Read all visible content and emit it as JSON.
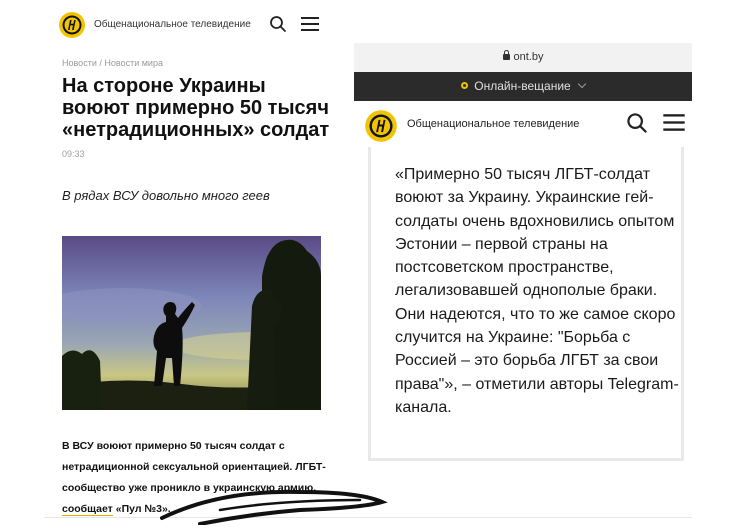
{
  "left": {
    "brand": "Общенациональное телевидение",
    "breadcrumb": [
      "Новости",
      "Новости мира"
    ],
    "breadcrumb_sep": "/",
    "headline": "На стороне Украины воюют примерно 50 тысяч «нетрадиционных» солдат",
    "time": "09:33",
    "lead": "В рядах ВСУ довольно много геев",
    "body_before": "В ВСУ воюют примерно 50 тысяч солдат с нетрадиционной сексуальной ориентацией. ЛГБТ-сообщество уже проникло в украинскую армию, ",
    "body_link": "сообщает",
    "body_after": " «Пул №3»."
  },
  "right": {
    "url": "ont.by",
    "live_label": "Онлайн-вещание",
    "brand": "Общенациональное телевидение",
    "quote": "«Примерно 50 тысяч ЛГБТ-солдат воюют за Украину. Украинские гей-солдаты очень вдохновились опытом Эстонии – первой страны на постсоветском пространстве, легализовавшей однополые браки. Они надеются, что то же самое скоро случится на Украине: \"Борьба с Россией – это борьба ЛГБТ за свои права\"», – отметили авторы Telegram-канала."
  },
  "icons": {
    "logo": "ont-logo-icon",
    "search": "search-icon",
    "menu": "hamburger-menu-icon",
    "lock": "lock-icon",
    "live": "live-dot-icon",
    "chevron": "chevron-down-icon"
  },
  "colors": {
    "logo_yellow": "#f2c400",
    "live_bar": "#2b2b2b",
    "text": "#1a1a1a"
  }
}
